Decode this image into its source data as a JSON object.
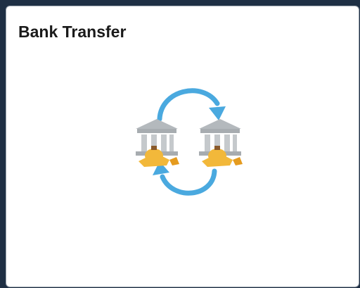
{
  "tile": {
    "title": "Bank Transfer",
    "icon": "bank-transfer-icon"
  },
  "colors": {
    "page_background": "#1e2f44",
    "tile_background": "#ffffff",
    "arrow": "#4aa9df",
    "bank": "#b4b9bd",
    "gold": "#f2b83a"
  }
}
